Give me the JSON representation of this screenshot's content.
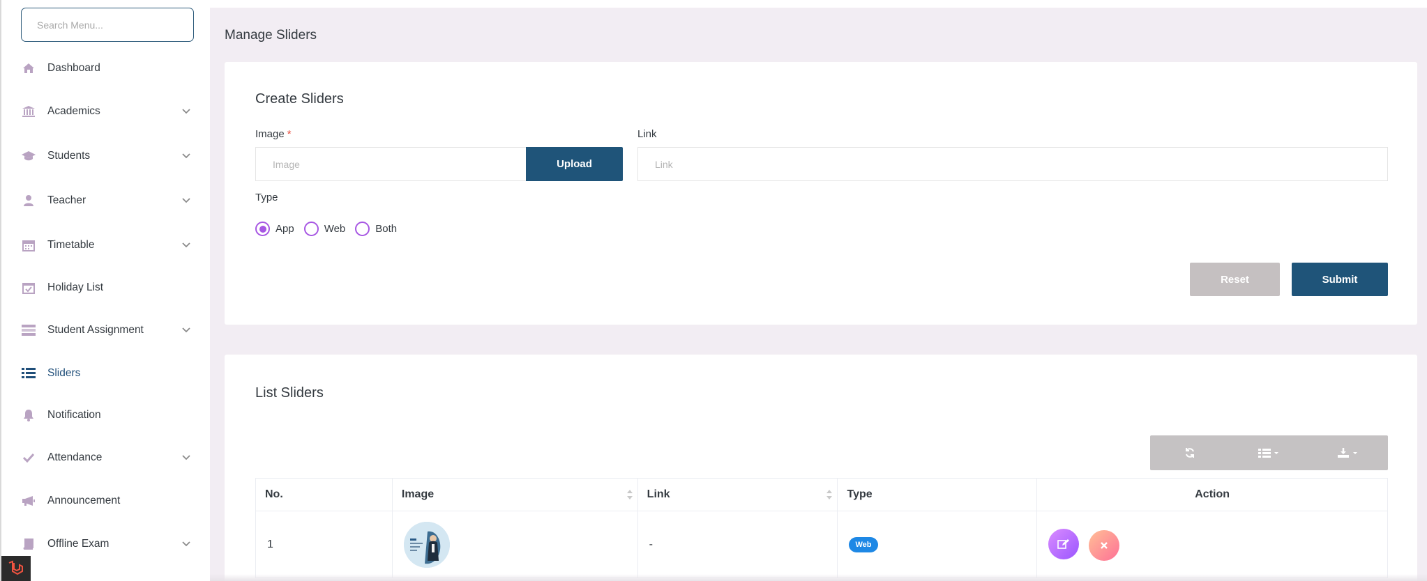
{
  "search": {
    "placeholder": "Search Menu..."
  },
  "sidebar": {
    "items": [
      {
        "label": "Dashboard",
        "icon": "home-icon",
        "expandable": false
      },
      {
        "label": "Academics",
        "icon": "bank-icon",
        "expandable": true
      },
      {
        "label": "Students",
        "icon": "graduation-cap-icon",
        "expandable": true
      },
      {
        "label": "Teacher",
        "icon": "user-icon",
        "expandable": true
      },
      {
        "label": "Timetable",
        "icon": "calendar-icon",
        "expandable": true
      },
      {
        "label": "Holiday List",
        "icon": "calendar-check-icon",
        "expandable": false
      },
      {
        "label": "Student Assignment",
        "icon": "tasks-icon",
        "expandable": true
      },
      {
        "label": "Sliders",
        "icon": "list-icon",
        "expandable": false,
        "active": true
      },
      {
        "label": "Notification",
        "icon": "bell-icon",
        "expandable": false
      },
      {
        "label": "Attendance",
        "icon": "check-icon",
        "expandable": true
      },
      {
        "label": "Announcement",
        "icon": "megaphone-icon",
        "expandable": false
      },
      {
        "label": "Offline Exam",
        "icon": "book-icon",
        "expandable": true
      }
    ]
  },
  "page": {
    "title": "Manage Sliders"
  },
  "create": {
    "title": "Create Sliders",
    "image_label": "Image",
    "required_mark": "*",
    "image_placeholder": "Image",
    "upload_label": "Upload",
    "link_label": "Link",
    "link_placeholder": "Link",
    "type_label": "Type",
    "types": [
      {
        "label": "App",
        "checked": true
      },
      {
        "label": "Web",
        "checked": false
      },
      {
        "label": "Both",
        "checked": false
      }
    ],
    "reset_label": "Reset",
    "submit_label": "Submit"
  },
  "list": {
    "title": "List Sliders",
    "toolbar": [
      "refresh-icon",
      "columns-icon",
      "export-icon"
    ],
    "columns": [
      "No.",
      "Image",
      "Link",
      "Type",
      "Action"
    ],
    "rows": [
      {
        "no": "1",
        "link": "-",
        "type": "Web"
      }
    ]
  },
  "colors": {
    "primary": "#1f5479",
    "radio": "#a757e3",
    "reset": "#c5c0c1",
    "badge": "#1e88e5",
    "background": "#f2edf3",
    "sidebar_icon": "#b9a3c2"
  }
}
